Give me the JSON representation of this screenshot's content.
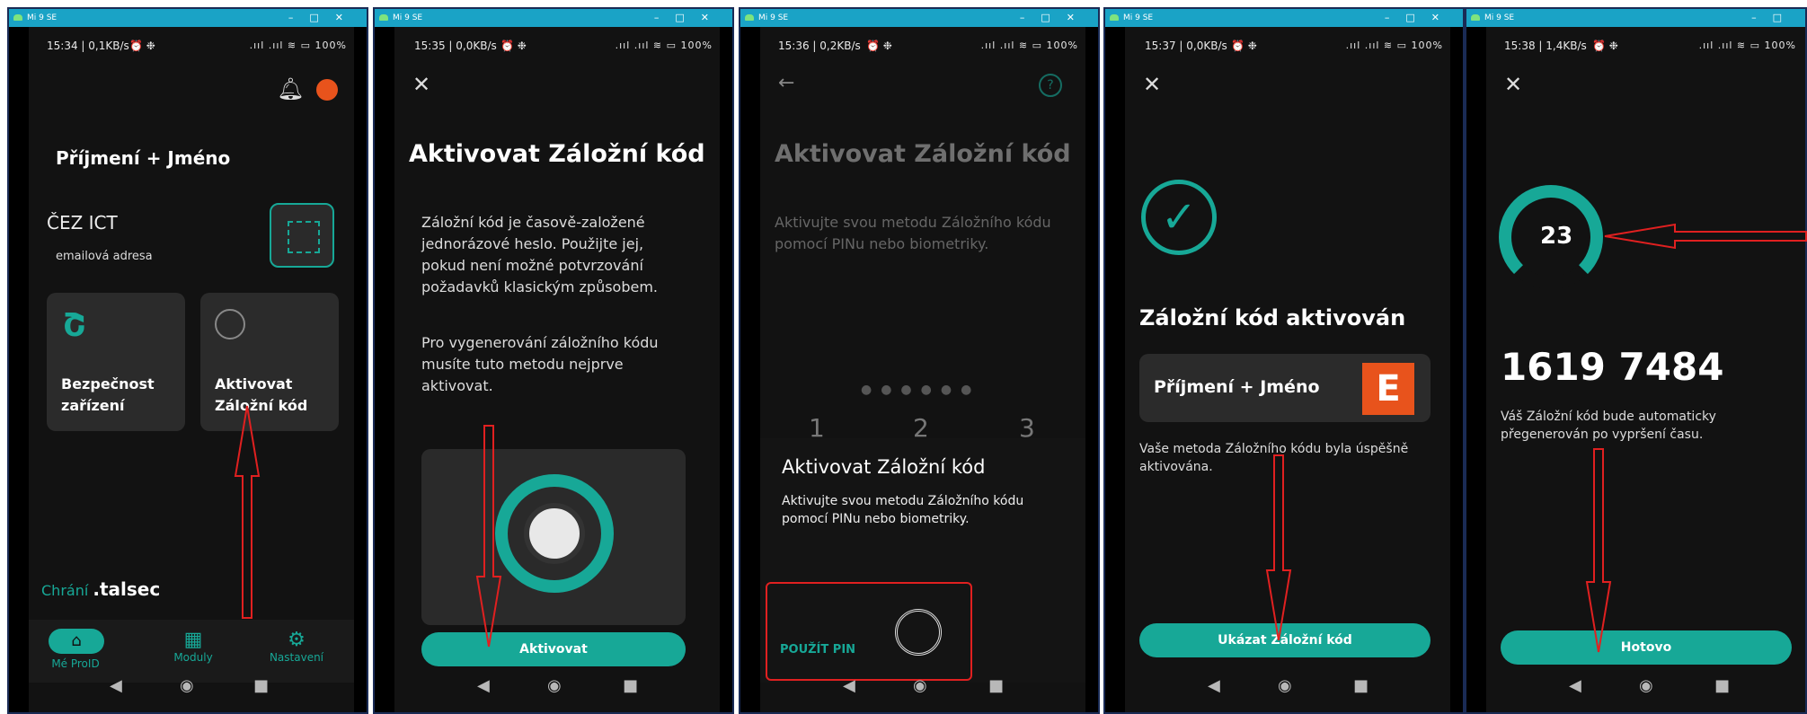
{
  "window_title": "Mi 9 SE",
  "panels": [
    {
      "status_time": "15:34 | 0,1KB/s",
      "battery": "100%",
      "user_name": "Příjmení + Jméno",
      "org": "ČEZ ICT",
      "email": "emailová adresa",
      "tiles": [
        "Bezpečnost zařízení",
        "Aktivovat Záložní kód"
      ],
      "protected_by": "Chrání",
      "brand": ".talsec",
      "tabs": [
        "Mé ProID",
        "Moduly",
        "Nastavení"
      ]
    },
    {
      "status_time": "15:35 | 0,0KB/s",
      "battery": "100%",
      "title": "Aktivovat Záložní kód",
      "para1": "Záložní kód je časově-založené jednorázové heslo. Použijte jej, pokud není možné potvrzování požadavků klasickým způsobem.",
      "para2": "Pro vygenerování záložního kódu musíte tuto metodu nejprve aktivovat.",
      "button": "Aktivovat"
    },
    {
      "status_time": "15:36 | 0,2KB/s",
      "battery": "100%",
      "title": "Aktivovat Záložní kód",
      "subtitle": "Aktivujte svou metodu Záložního kódu pomocí PINu nebo biometriky.",
      "keys": [
        "1",
        "2",
        "3"
      ],
      "dialog_title": "Aktivovat Záložní kód",
      "dialog_text": "Aktivujte svou metodu Záložního kódu pomocí PINu nebo biometriky.",
      "use_pin": "POUŽÍT PIN"
    },
    {
      "status_time": "15:37 | 0,0KB/s",
      "battery": "100%",
      "title": "Záložní kód aktivován",
      "user_name": "Příjmení + Jméno",
      "text": "Vaše metoda Záložního kódu byla úspěšně aktivována.",
      "button": "Ukázat Záložní kód"
    },
    {
      "status_time": "15:38 | 1,4KB/s",
      "battery": "100%",
      "countdown": "23",
      "code": "1619 7484",
      "text": "Váš Záložní kód bude automaticky přegenerován po vypršení času.",
      "button": "Hotovo"
    }
  ],
  "colors": {
    "accent": "#17a897",
    "orange": "#e8531c",
    "arrow": "#e02020"
  }
}
